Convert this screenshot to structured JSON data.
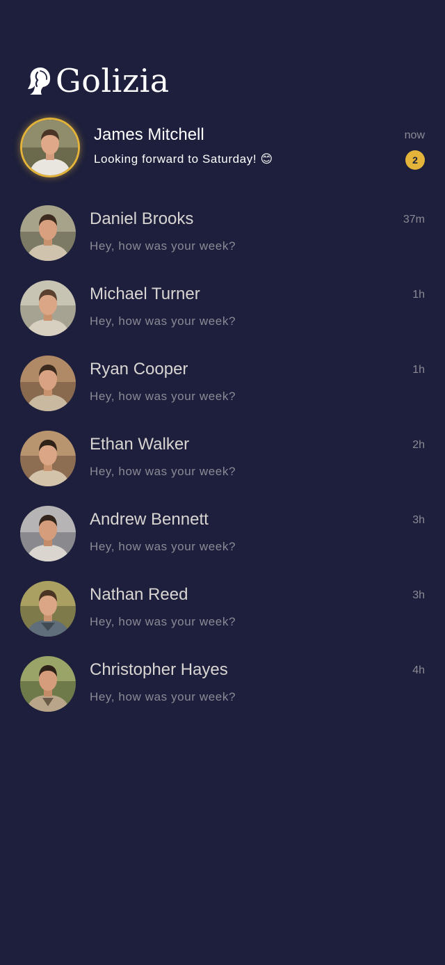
{
  "app": {
    "brand": "Golizia",
    "logo_icon": "woman-profile-logo-icon",
    "accent_color": "#e4b43a",
    "background_color": "#1d1f3c"
  },
  "conversations": [
    {
      "name": "James Mitchell",
      "preview": "Looking forward to Saturday! 😊",
      "time": "now",
      "unread": "2",
      "featured": true
    },
    {
      "name": "Daniel Brooks",
      "preview": "Hey, how was your week?",
      "time": "37m"
    },
    {
      "name": "Michael Turner",
      "preview": "Hey, how was your week?",
      "time": "1h"
    },
    {
      "name": "Ryan Cooper",
      "preview": "Hey, how was your week?",
      "time": "1h"
    },
    {
      "name": "Ethan Walker",
      "preview": "Hey, how was your week?",
      "time": "2h"
    },
    {
      "name": "Andrew Bennett",
      "preview": "Hey, how was your week?",
      "time": "3h"
    },
    {
      "name": "Nathan Reed",
      "preview": "Hey, how was your week?",
      "time": "3h"
    },
    {
      "name": "Christopher Hayes",
      "preview": "Hey, how was your week?",
      "time": "4h"
    }
  ]
}
